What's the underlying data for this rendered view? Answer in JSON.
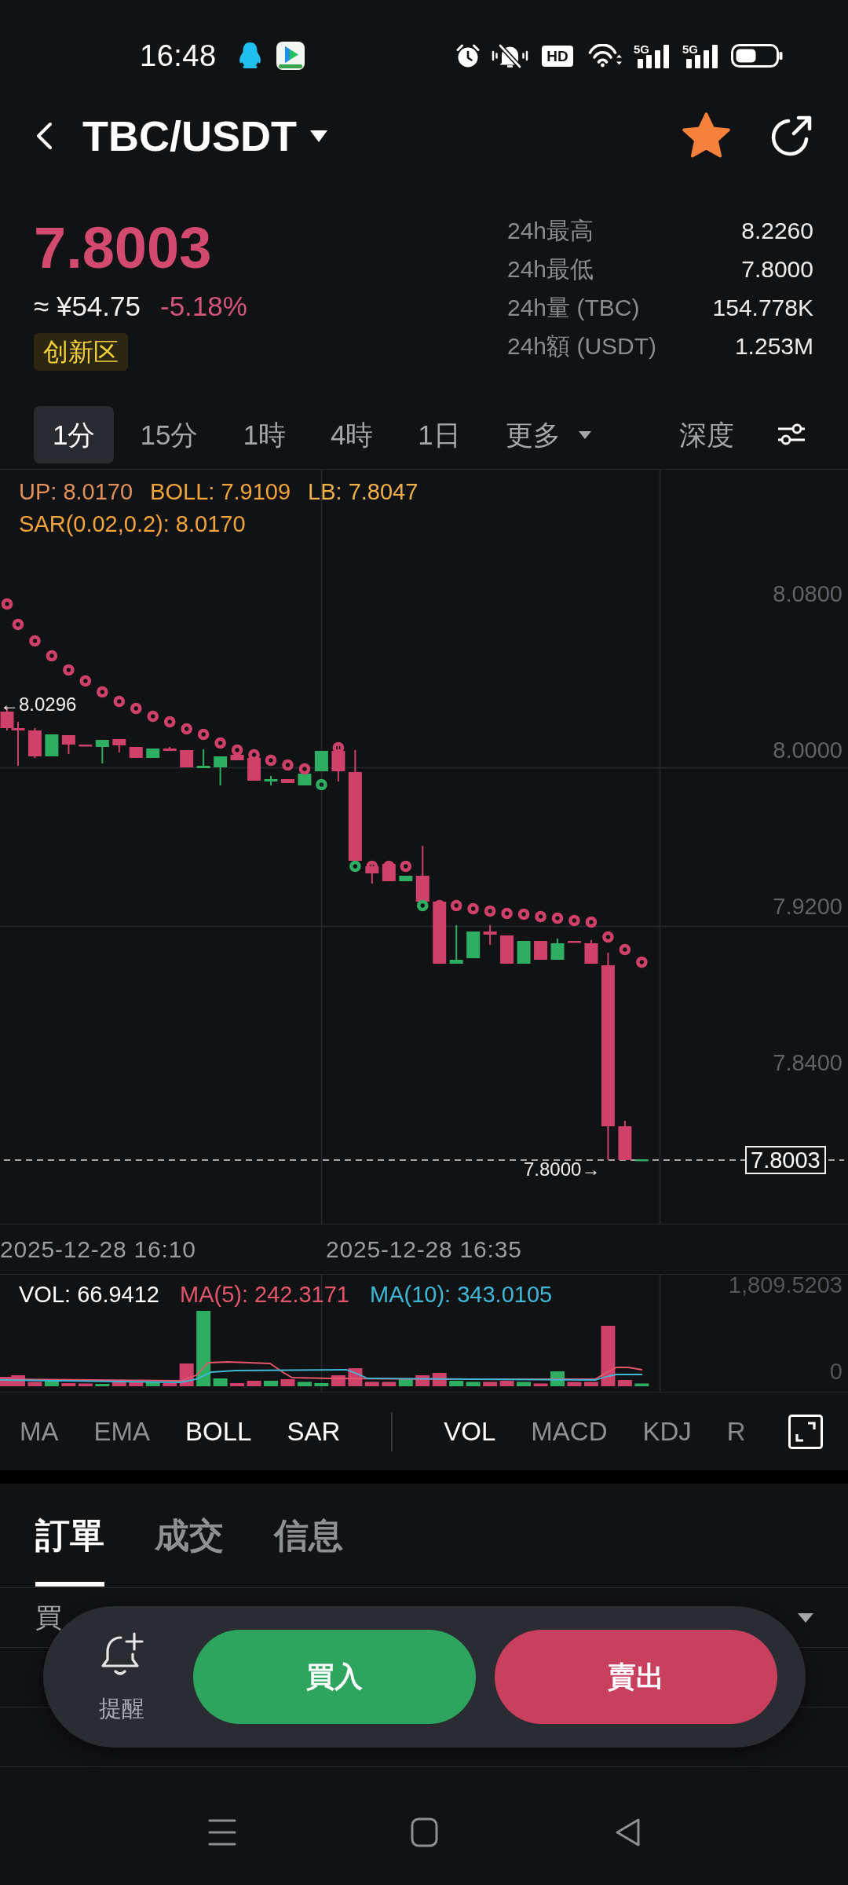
{
  "status_bar": {
    "time": "16:48",
    "hd_label": "HD",
    "networks": [
      {
        "label": "5G"
      },
      {
        "label": "5G"
      }
    ]
  },
  "header": {
    "pair": "TBC/USDT",
    "favorite": true
  },
  "ticker": {
    "price": "7.8003",
    "fiat_price": "≈ ¥54.75",
    "change": "-5.18%",
    "zone_tag": "创新区",
    "stats": [
      {
        "label": "24h最高",
        "value": "8.2260"
      },
      {
        "label": "24h最低",
        "value": "7.8000"
      },
      {
        "label": "24h量 (TBC)",
        "value": "154.778K"
      },
      {
        "label": "24h額 (USDT)",
        "value": "1.253M"
      }
    ]
  },
  "intervals": [
    {
      "label": "1分",
      "selected": true
    },
    {
      "label": "15分",
      "selected": false
    },
    {
      "label": "1時",
      "selected": false
    },
    {
      "label": "4時",
      "selected": false
    },
    {
      "label": "1日",
      "selected": false
    }
  ],
  "more_menu": {
    "label": "更多"
  },
  "depth_tab": {
    "label": "深度",
    "selected": false
  },
  "chart": {
    "legend": [
      {
        "text": "UP: 8.0170",
        "color": "#e0905a"
      },
      {
        "text": "BOLL: 7.9109",
        "color": "#f2a33a"
      },
      {
        "text": "LB: 7.8047",
        "color": "#f0b04a"
      },
      {
        "text": "SAR(0.02,0.2): 8.0170",
        "color": "#f2a33a"
      }
    ],
    "price_axis": [
      "8.0800",
      "8.0000",
      "7.9200",
      "7.8400"
    ],
    "high_marker": "←8.0296",
    "low_marker": "7.8000→",
    "current_price": "7.8003",
    "time_axis": [
      "2025-12-28 16:10",
      "2025-12-28 16:35"
    ]
  },
  "volume": {
    "legend": [
      {
        "text": "VOL: 66.9412",
        "color": "#ffffff"
      },
      {
        "text": "MA(5): 242.3171",
        "color": "#e4566e"
      },
      {
        "text": "MA(10): 343.0105",
        "color": "#3fb8d6"
      }
    ],
    "axis": [
      "1,809.5203",
      "0"
    ]
  },
  "main_indicators": [
    {
      "label": "MA",
      "selected": false
    },
    {
      "label": "EMA",
      "selected": false
    },
    {
      "label": "BOLL",
      "selected": true
    },
    {
      "label": "SAR",
      "selected": true
    }
  ],
  "sub_indicators": [
    {
      "label": "VOL",
      "selected": true
    },
    {
      "label": "MACD",
      "selected": false
    },
    {
      "label": "KDJ",
      "selected": false
    },
    {
      "label": "R",
      "selected": false
    }
  ],
  "detail_tabs": [
    {
      "label": "訂單",
      "selected": true
    },
    {
      "label": "成交",
      "selected": false
    },
    {
      "label": "信息",
      "selected": false
    }
  ],
  "order_book": {
    "column_1": "買"
  },
  "action_bar": {
    "alert": "提醒",
    "buy": "買入",
    "sell": "賣出"
  }
}
